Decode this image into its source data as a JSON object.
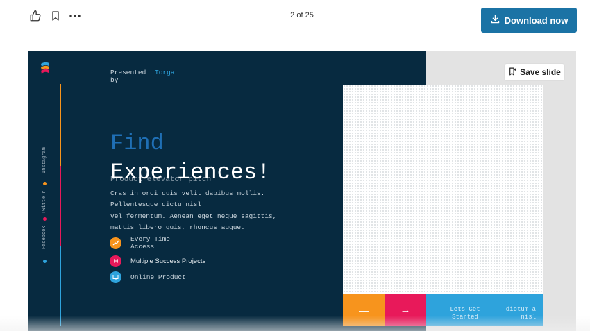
{
  "toolbar": {
    "like_icon": "thumbs-up-icon",
    "bookmark_icon": "bookmark-icon",
    "more_icon": "more-horizontal-icon",
    "page_indicator": "2 of 25",
    "download_label": "Download now",
    "download_color": "#1b73a5"
  },
  "viewer": {
    "save_slide_label": "Save slide"
  },
  "slide": {
    "background": "#072a40",
    "presented_by": "Presented by",
    "presenter": "Torga",
    "social": [
      "Instagram",
      "Twitte r",
      "Facebook"
    ],
    "heading_line1": "Find",
    "heading_line2": "Experiences!",
    "subtitle": "Product elevator pitch",
    "body_lines": [
      "Cras in orci quis velit dapibus mollis.",
      "Pellentesque dictu nisl",
      "vel fermentum. Aenean eget neque sagittis,",
      "mattis libero quis, rhoncus augue."
    ],
    "features": [
      {
        "label": "Every Time Access",
        "icon": "trend-chart-icon",
        "color": "#f7941d"
      },
      {
        "label": "Multiple Success Projects",
        "icon": "grid-icon",
        "color": "#e8195a"
      },
      {
        "label": "Online Product",
        "icon": "monitor-icon",
        "color": "#2ea3dc"
      }
    ],
    "cta": {
      "minus_symbol": "—",
      "arrow_symbol": "→",
      "lets_get_started": "Lets Get Started",
      "dictum": "dictum a nisl"
    }
  }
}
